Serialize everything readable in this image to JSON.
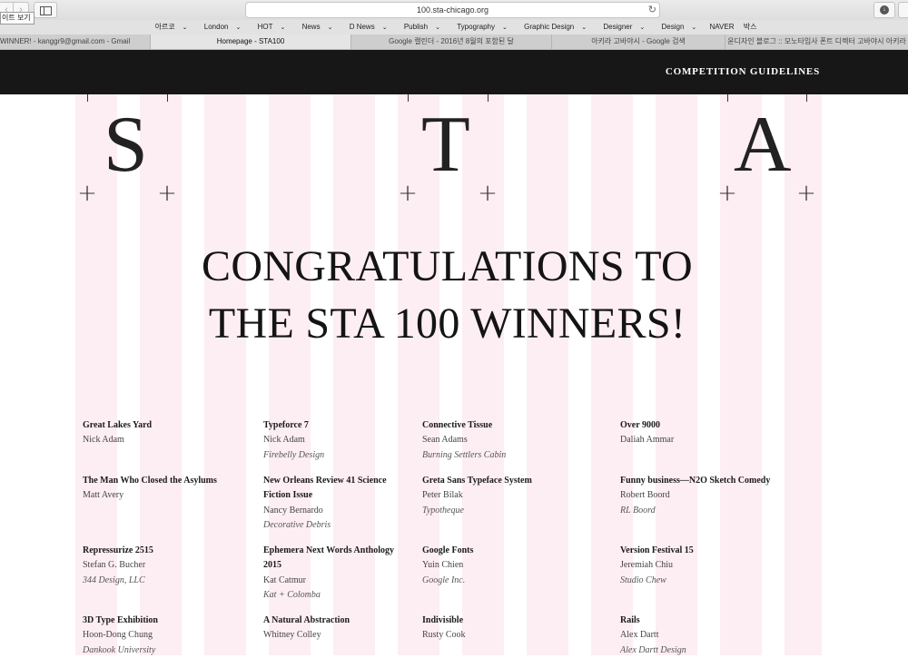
{
  "browser": {
    "reader_tooltip": "이트 보기",
    "url": "100.sta-chicago.org",
    "bookmarks": [
      "아르코",
      "London",
      "HOT",
      "News",
      "D News",
      "Publish",
      "Typography",
      "Graphic Design",
      "Designer",
      "Design",
      "NAVER",
      "박스"
    ],
    "tabs": [
      "WINNER! - kanggr9@gmail.com - Gmail",
      "Homepage - STA100",
      "Google 캘린더 - 2016년 8월의 포함된 달",
      "아키라 고바야시 - Google 검색",
      "윤디자인 블로그 :: 모노타입사 폰트 디렉터 고바야시 아키라"
    ]
  },
  "header": {
    "guidelines_label": "COMPETITION GUIDELINES"
  },
  "hero": {
    "letters": [
      "S",
      "T",
      "A"
    ],
    "headline_line1": "CONGRATULATIONS TO",
    "headline_line2": "THE STA 100 WINNERS!"
  },
  "winners": [
    {
      "title": "Great Lakes Yard",
      "name": "Nick Adam",
      "studio": ""
    },
    {
      "title": "Typeforce 7",
      "name": "Nick Adam",
      "studio": "Firebelly Design"
    },
    {
      "title": "Connective Tissue",
      "name": "Sean Adams",
      "studio": "Burning Settlers Cabin"
    },
    {
      "title": "Over 9000",
      "name": "Daliah Ammar",
      "studio": ""
    },
    {
      "title": "The Man Who Closed the Asylums",
      "name": "Matt Avery",
      "studio": ""
    },
    {
      "title": "New Orleans Review 41 Science Fiction Issue",
      "name": "Nancy Bernardo",
      "studio": "Decorative Debris"
    },
    {
      "title": "Greta Sans Typeface System",
      "name": "Peter Bilak",
      "studio": "Typotheque"
    },
    {
      "title": "Funny business—N2O Sketch Comedy",
      "name": "Robert Boord",
      "studio": "RL Boord"
    },
    {
      "title": "Repressurize 2515",
      "name": "Stefan G. Bucher",
      "studio": "344 Design, LLC"
    },
    {
      "title": "Ephemera Next Words Anthology 2015",
      "name": "Kat Catmur",
      "studio": "Kat + Colomba"
    },
    {
      "title": "Google Fonts",
      "name": "Yuin Chien",
      "studio": "Google Inc."
    },
    {
      "title": "Version Festival 15",
      "name": "Jeremiah Chiu",
      "studio": "Studio Chew"
    },
    {
      "title": "3D Type Exhibition",
      "name": "Hoon-Dong Chung",
      "studio": "Dankook University"
    },
    {
      "title": "A Natural Abstraction",
      "name": "Whitney Colley",
      "studio": ""
    },
    {
      "title": "Indivisible",
      "name": "Rusty Cook",
      "studio": ""
    },
    {
      "title": "Rails",
      "name": "Alex Dartt",
      "studio": "Alex Dartt Design"
    }
  ]
}
